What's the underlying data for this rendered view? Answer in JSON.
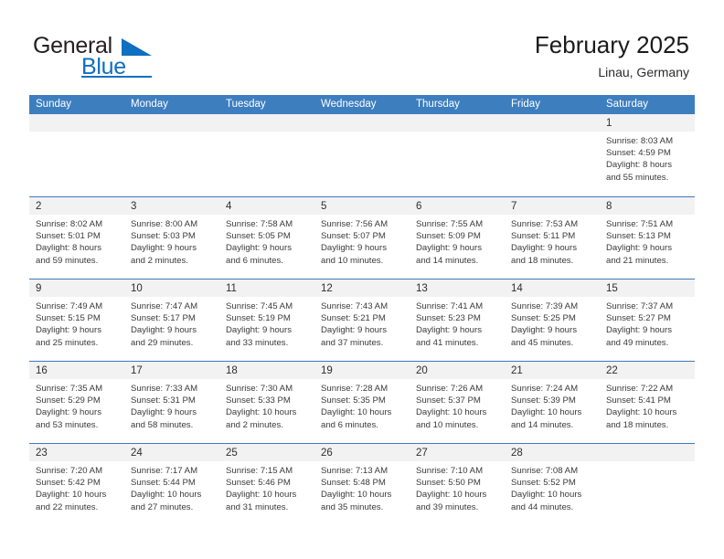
{
  "brand": {
    "word_one": "General",
    "word_two": "Blue",
    "accent_color": "#0f6fc0"
  },
  "header": {
    "title": "February 2025",
    "subtitle": "Linau, Germany"
  },
  "calendar": {
    "header_color": "#3d7ebf",
    "weekdays": [
      "Sunday",
      "Monday",
      "Tuesday",
      "Wednesday",
      "Thursday",
      "Friday",
      "Saturday"
    ],
    "weeks": [
      [
        {
          "day": "",
          "empty": true
        },
        {
          "day": "",
          "empty": true
        },
        {
          "day": "",
          "empty": true
        },
        {
          "day": "",
          "empty": true
        },
        {
          "day": "",
          "empty": true
        },
        {
          "day": "",
          "empty": true
        },
        {
          "day": "1",
          "sunrise": "Sunrise: 8:03 AM",
          "sunset": "Sunset: 4:59 PM",
          "daylight_line1": "Daylight: 8 hours",
          "daylight_line2": "and 55 minutes."
        }
      ],
      [
        {
          "day": "2",
          "sunrise": "Sunrise: 8:02 AM",
          "sunset": "Sunset: 5:01 PM",
          "daylight_line1": "Daylight: 8 hours",
          "daylight_line2": "and 59 minutes."
        },
        {
          "day": "3",
          "sunrise": "Sunrise: 8:00 AM",
          "sunset": "Sunset: 5:03 PM",
          "daylight_line1": "Daylight: 9 hours",
          "daylight_line2": "and 2 minutes."
        },
        {
          "day": "4",
          "sunrise": "Sunrise: 7:58 AM",
          "sunset": "Sunset: 5:05 PM",
          "daylight_line1": "Daylight: 9 hours",
          "daylight_line2": "and 6 minutes."
        },
        {
          "day": "5",
          "sunrise": "Sunrise: 7:56 AM",
          "sunset": "Sunset: 5:07 PM",
          "daylight_line1": "Daylight: 9 hours",
          "daylight_line2": "and 10 minutes."
        },
        {
          "day": "6",
          "sunrise": "Sunrise: 7:55 AM",
          "sunset": "Sunset: 5:09 PM",
          "daylight_line1": "Daylight: 9 hours",
          "daylight_line2": "and 14 minutes."
        },
        {
          "day": "7",
          "sunrise": "Sunrise: 7:53 AM",
          "sunset": "Sunset: 5:11 PM",
          "daylight_line1": "Daylight: 9 hours",
          "daylight_line2": "and 18 minutes."
        },
        {
          "day": "8",
          "sunrise": "Sunrise: 7:51 AM",
          "sunset": "Sunset: 5:13 PM",
          "daylight_line1": "Daylight: 9 hours",
          "daylight_line2": "and 21 minutes."
        }
      ],
      [
        {
          "day": "9",
          "sunrise": "Sunrise: 7:49 AM",
          "sunset": "Sunset: 5:15 PM",
          "daylight_line1": "Daylight: 9 hours",
          "daylight_line2": "and 25 minutes."
        },
        {
          "day": "10",
          "sunrise": "Sunrise: 7:47 AM",
          "sunset": "Sunset: 5:17 PM",
          "daylight_line1": "Daylight: 9 hours",
          "daylight_line2": "and 29 minutes."
        },
        {
          "day": "11",
          "sunrise": "Sunrise: 7:45 AM",
          "sunset": "Sunset: 5:19 PM",
          "daylight_line1": "Daylight: 9 hours",
          "daylight_line2": "and 33 minutes."
        },
        {
          "day": "12",
          "sunrise": "Sunrise: 7:43 AM",
          "sunset": "Sunset: 5:21 PM",
          "daylight_line1": "Daylight: 9 hours",
          "daylight_line2": "and 37 minutes."
        },
        {
          "day": "13",
          "sunrise": "Sunrise: 7:41 AM",
          "sunset": "Sunset: 5:23 PM",
          "daylight_line1": "Daylight: 9 hours",
          "daylight_line2": "and 41 minutes."
        },
        {
          "day": "14",
          "sunrise": "Sunrise: 7:39 AM",
          "sunset": "Sunset: 5:25 PM",
          "daylight_line1": "Daylight: 9 hours",
          "daylight_line2": "and 45 minutes."
        },
        {
          "day": "15",
          "sunrise": "Sunrise: 7:37 AM",
          "sunset": "Sunset: 5:27 PM",
          "daylight_line1": "Daylight: 9 hours",
          "daylight_line2": "and 49 minutes."
        }
      ],
      [
        {
          "day": "16",
          "sunrise": "Sunrise: 7:35 AM",
          "sunset": "Sunset: 5:29 PM",
          "daylight_line1": "Daylight: 9 hours",
          "daylight_line2": "and 53 minutes."
        },
        {
          "day": "17",
          "sunrise": "Sunrise: 7:33 AM",
          "sunset": "Sunset: 5:31 PM",
          "daylight_line1": "Daylight: 9 hours",
          "daylight_line2": "and 58 minutes."
        },
        {
          "day": "18",
          "sunrise": "Sunrise: 7:30 AM",
          "sunset": "Sunset: 5:33 PM",
          "daylight_line1": "Daylight: 10 hours",
          "daylight_line2": "and 2 minutes."
        },
        {
          "day": "19",
          "sunrise": "Sunrise: 7:28 AM",
          "sunset": "Sunset: 5:35 PM",
          "daylight_line1": "Daylight: 10 hours",
          "daylight_line2": "and 6 minutes."
        },
        {
          "day": "20",
          "sunrise": "Sunrise: 7:26 AM",
          "sunset": "Sunset: 5:37 PM",
          "daylight_line1": "Daylight: 10 hours",
          "daylight_line2": "and 10 minutes."
        },
        {
          "day": "21",
          "sunrise": "Sunrise: 7:24 AM",
          "sunset": "Sunset: 5:39 PM",
          "daylight_line1": "Daylight: 10 hours",
          "daylight_line2": "and 14 minutes."
        },
        {
          "day": "22",
          "sunrise": "Sunrise: 7:22 AM",
          "sunset": "Sunset: 5:41 PM",
          "daylight_line1": "Daylight: 10 hours",
          "daylight_line2": "and 18 minutes."
        }
      ],
      [
        {
          "day": "23",
          "sunrise": "Sunrise: 7:20 AM",
          "sunset": "Sunset: 5:42 PM",
          "daylight_line1": "Daylight: 10 hours",
          "daylight_line2": "and 22 minutes."
        },
        {
          "day": "24",
          "sunrise": "Sunrise: 7:17 AM",
          "sunset": "Sunset: 5:44 PM",
          "daylight_line1": "Daylight: 10 hours",
          "daylight_line2": "and 27 minutes."
        },
        {
          "day": "25",
          "sunrise": "Sunrise: 7:15 AM",
          "sunset": "Sunset: 5:46 PM",
          "daylight_line1": "Daylight: 10 hours",
          "daylight_line2": "and 31 minutes."
        },
        {
          "day": "26",
          "sunrise": "Sunrise: 7:13 AM",
          "sunset": "Sunset: 5:48 PM",
          "daylight_line1": "Daylight: 10 hours",
          "daylight_line2": "and 35 minutes."
        },
        {
          "day": "27",
          "sunrise": "Sunrise: 7:10 AM",
          "sunset": "Sunset: 5:50 PM",
          "daylight_line1": "Daylight: 10 hours",
          "daylight_line2": "and 39 minutes."
        },
        {
          "day": "28",
          "sunrise": "Sunrise: 7:08 AM",
          "sunset": "Sunset: 5:52 PM",
          "daylight_line1": "Daylight: 10 hours",
          "daylight_line2": "and 44 minutes."
        },
        {
          "day": "",
          "empty": true
        }
      ]
    ]
  }
}
